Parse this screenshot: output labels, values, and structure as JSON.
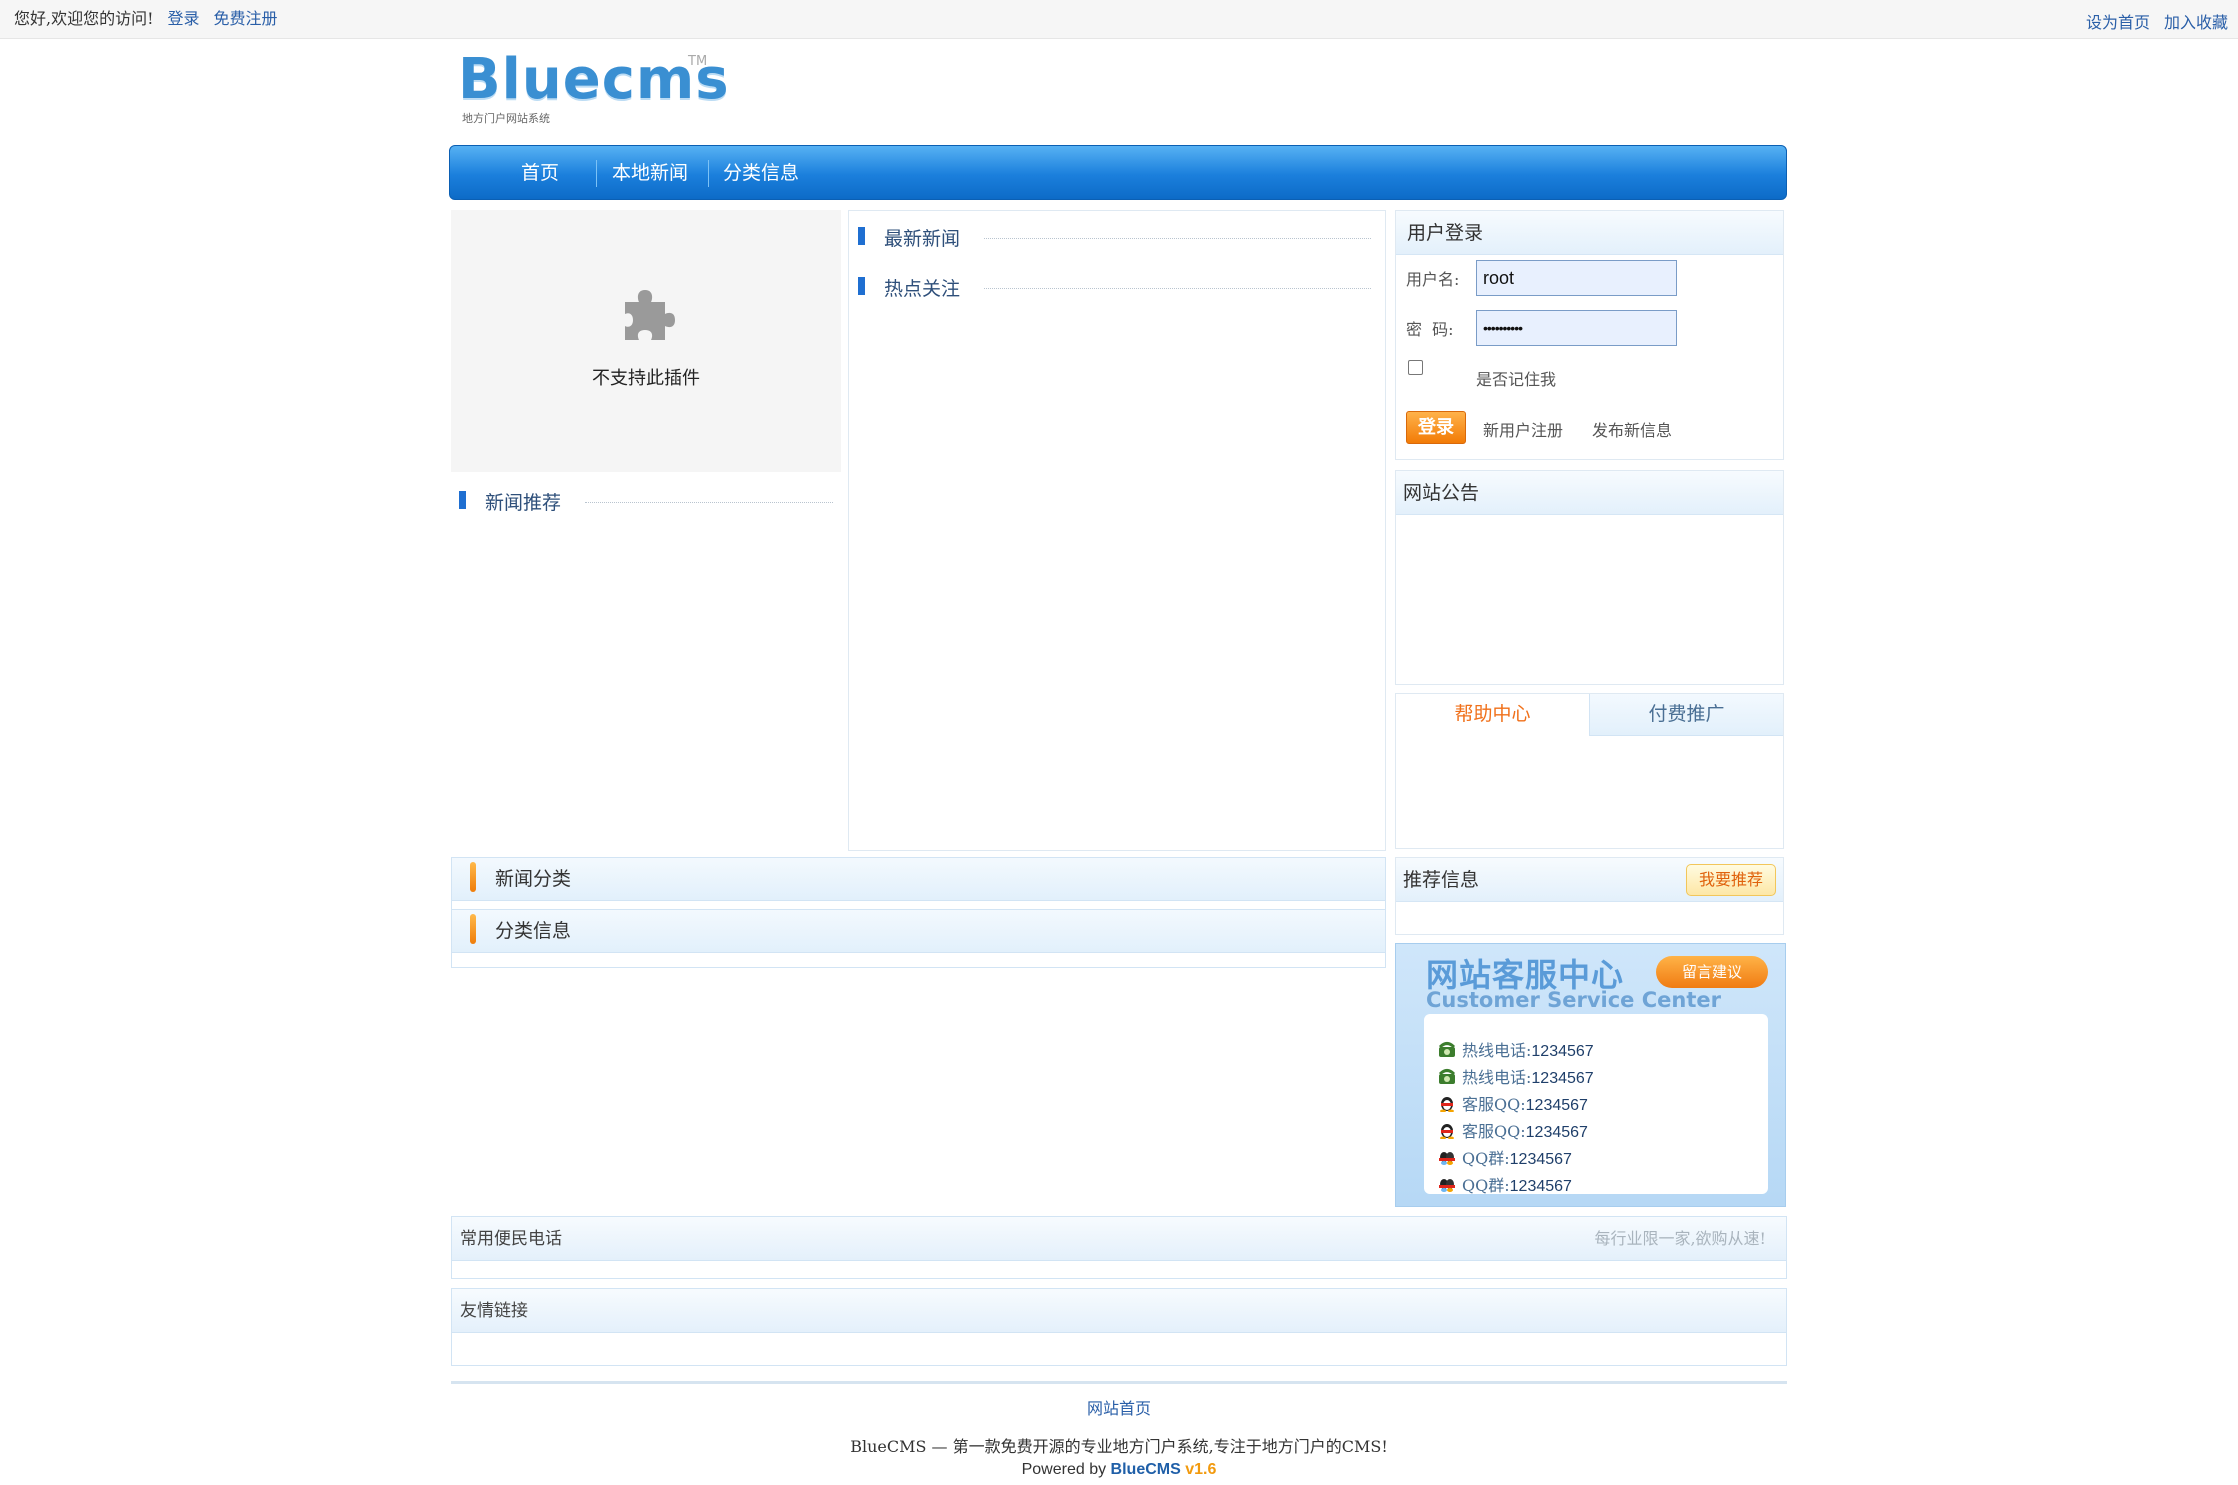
{
  "topbar": {
    "welcome": "您好,欢迎您的访问!",
    "login": "登录",
    "register": "免费注册",
    "set_home": "设为首页",
    "bookmark": "加入收藏"
  },
  "logo": {
    "text": "Bluecms",
    "tm": "TM",
    "subtitle": "地方门户网站系统"
  },
  "nav": {
    "items": [
      "首页",
      "本地新闻",
      "分类信息"
    ]
  },
  "plugin": {
    "message": "不支持此插件"
  },
  "sections": {
    "latest_news": "最新新闻",
    "hot_topics": "热点关注",
    "recommended_news": "新闻推荐"
  },
  "login_panel": {
    "title": "用户登录",
    "username_label": "用户名:",
    "username_value": "root",
    "password_label": "密  码:",
    "password_mask": "••••••••••",
    "remember_label": "是否记住我",
    "login_button": "登录",
    "new_user_register": "新用户注册",
    "post_new_info": "发布新信息"
  },
  "announcement": {
    "title": "网站公告"
  },
  "help_tabs": {
    "tab_help": "帮助中心",
    "tab_paid": "付费推广"
  },
  "categories": {
    "news_category": "新闻分类",
    "classified_info": "分类信息"
  },
  "recommend": {
    "title": "推荐信息",
    "button": "我要推荐"
  },
  "customer_service": {
    "title_cn": "网站客服中心",
    "title_en": "Customer Service Center",
    "message_button": "留言建议",
    "rows": [
      {
        "icon": "phone-icon",
        "label": "热线电话:",
        "value": "1234567"
      },
      {
        "icon": "phone-icon",
        "label": "热线电话:",
        "value": "1234567"
      },
      {
        "icon": "qq-penguin-icon",
        "label": "客服QQ:",
        "value": "1234567"
      },
      {
        "icon": "qq-penguin-icon",
        "label": "客服QQ:",
        "value": "1234567"
      },
      {
        "icon": "qq-group-icon",
        "label": "QQ群:",
        "value": "1234567"
      },
      {
        "icon": "qq-group-icon",
        "label": "QQ群:",
        "value": "1234567"
      }
    ]
  },
  "phones": {
    "title": "常用便民电话",
    "note": "每行业限一家,欲购从速!"
  },
  "links": {
    "title": "友情链接"
  },
  "footer": {
    "home_link": "网站首页",
    "tagline": "BlueCMS — 第一款免费开源的专业地方门户系统,专注于地方门户的CMS!",
    "powered_prefix": "Powered by ",
    "powered_brand": "BlueCMS",
    "powered_version": " v1.6"
  },
  "colors": {
    "nav_blue": "#1b7fdc",
    "accent_orange": "#f27b06",
    "link_blue": "#2a5fa8"
  }
}
